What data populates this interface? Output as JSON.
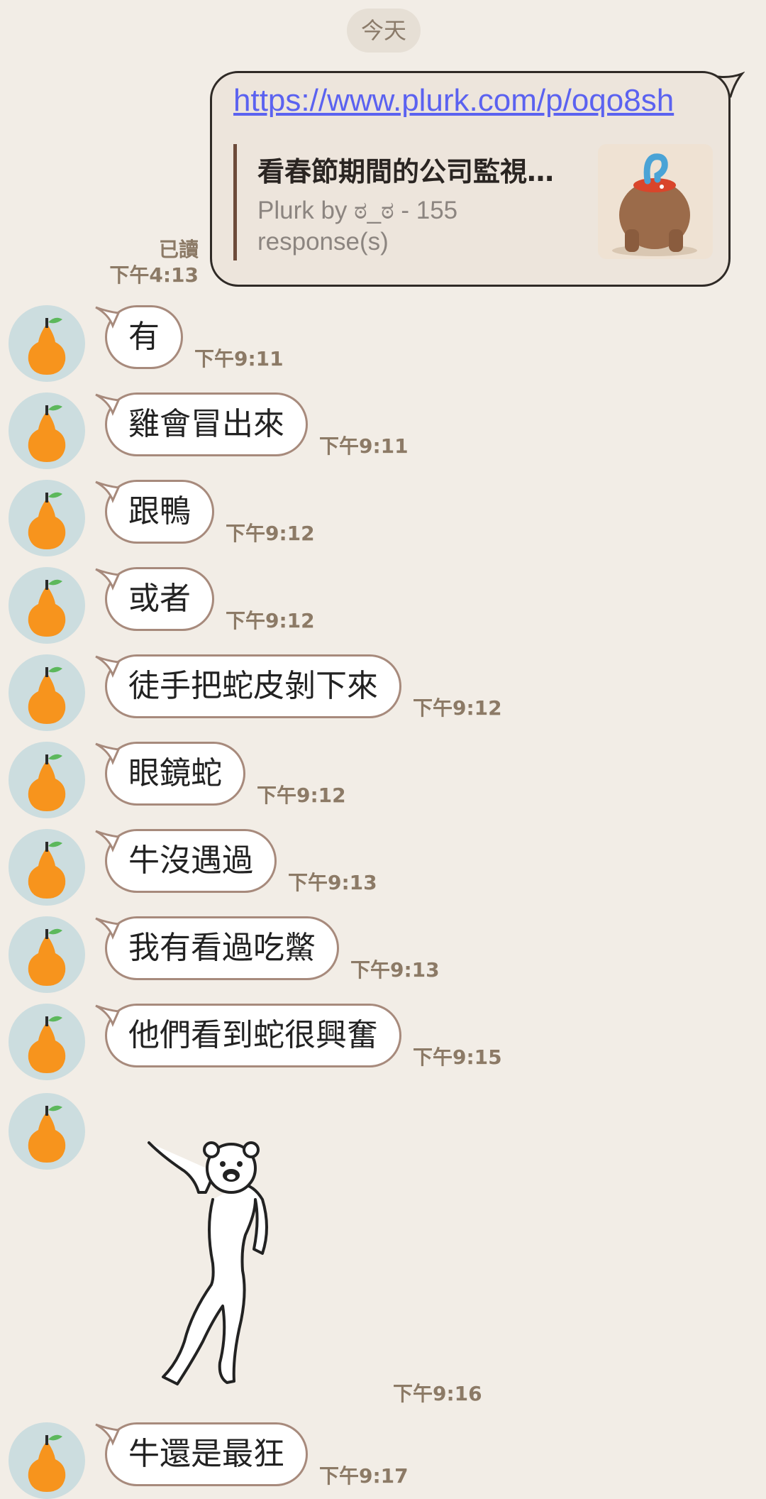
{
  "date_divider": "今天",
  "outgoing": {
    "url": "https://www.plurk.com/p/oqo8sh",
    "preview_title": "看春節期間的公司監視…",
    "preview_desc": "Plurk by ಠ_ಠ - 155 response(s)",
    "read_status": "已讀",
    "time": "下午4:13"
  },
  "messages": [
    {
      "text": "有",
      "time": "下午9:11"
    },
    {
      "text": "雞會冒出來",
      "time": "下午9:11"
    },
    {
      "text": "跟鴨",
      "time": "下午9:12"
    },
    {
      "text": "或者",
      "time": "下午9:12"
    },
    {
      "text": "徒手把蛇皮剝下來",
      "time": "下午9:12"
    },
    {
      "text": "眼鏡蛇",
      "time": "下午9:12"
    },
    {
      "text": "牛沒遇過",
      "time": "下午9:13"
    },
    {
      "text": "我有看過吃鱉",
      "time": "下午9:13"
    },
    {
      "text": "他們看到蛇很興奮",
      "time": "下午9:15"
    }
  ],
  "sticker": {
    "time": "下午9:16"
  },
  "last_message": {
    "text": "牛還是最狂",
    "time": "下午9:17"
  },
  "colors": {
    "background": "#f2ede6",
    "bubble_border": "#a78a7c",
    "timestamp": "#8c7a66",
    "link": "#5b62f0",
    "avatar_bg": "#ccdddf",
    "pear": "#f7941d"
  },
  "icons": {
    "avatar": "pear-icon",
    "sticker": "dancing-bear-sticker",
    "thumbnail": "bear-question-thumbnail"
  }
}
